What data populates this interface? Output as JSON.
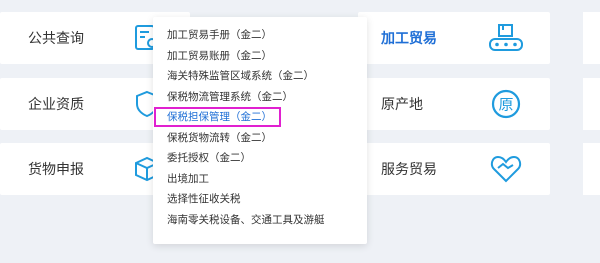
{
  "left_cards": [
    {
      "label": "公共查询",
      "icon": "search-doc-icon"
    },
    {
      "label": "企业资质",
      "icon": "shield-icon"
    },
    {
      "label": "货物申报",
      "icon": "box-icon"
    }
  ],
  "right_cards": [
    {
      "label": "加工贸易",
      "icon": "conveyor-icon",
      "active": true
    },
    {
      "label": "原产地",
      "icon": "origin-icon"
    },
    {
      "label": "服务贸易",
      "icon": "handshake-icon"
    }
  ],
  "dropdown": {
    "items": [
      "加工贸易手册（金二）",
      "加工贸易账册（金二）",
      "海关特殊监管区域系统（金二）",
      "保税物流管理系统（金二）",
      "保税担保管理（金二）",
      "保税货物流转（金二）",
      "委托授权（金二）",
      "出境加工",
      "选择性征收关税",
      "海南零关税设备、交通工具及游艇"
    ],
    "highlighted_index": 4
  },
  "colors": {
    "accent": "#1f6fd6",
    "highlight_border": "#e020d0",
    "background": "#eef1f6"
  }
}
